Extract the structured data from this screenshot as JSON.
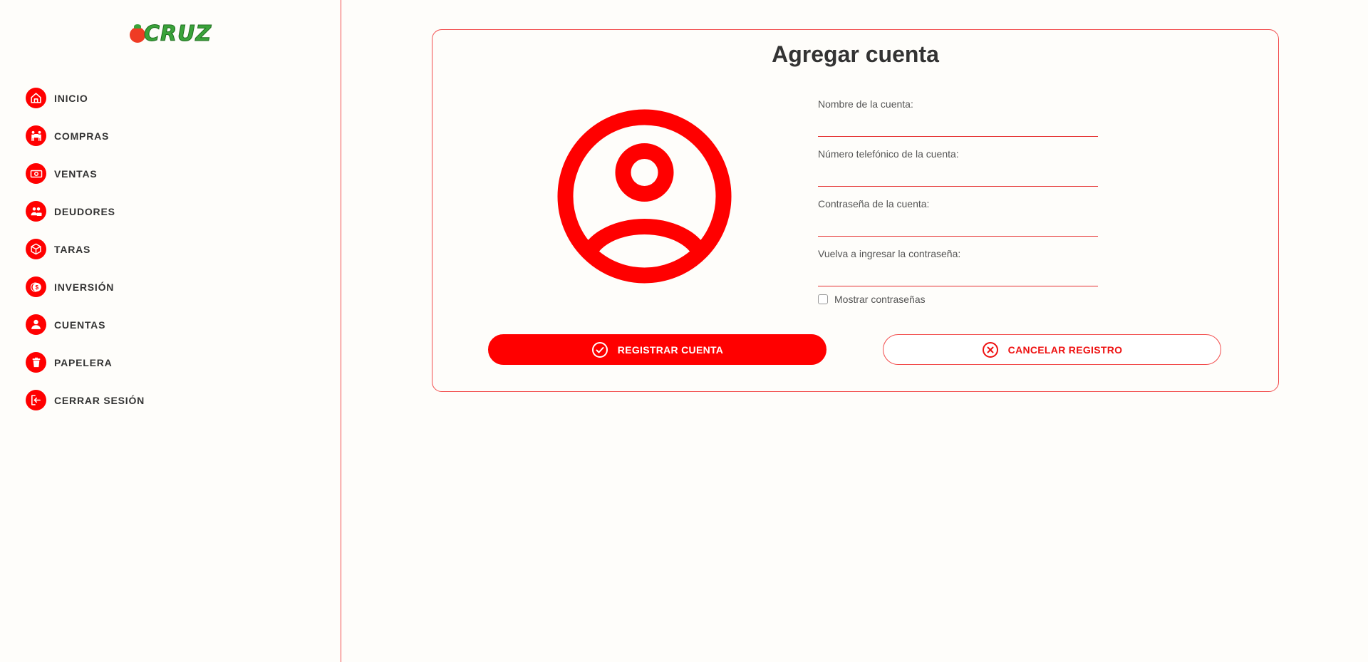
{
  "brand": {
    "logo_text": "CRUZ"
  },
  "sidebar": {
    "items": [
      {
        "label": "INICIO",
        "icon": "home-icon"
      },
      {
        "label": "COMPRAS",
        "icon": "cart-icon"
      },
      {
        "label": "VENTAS",
        "icon": "money-icon"
      },
      {
        "label": "DEUDORES",
        "icon": "debtors-icon"
      },
      {
        "label": "TARAS",
        "icon": "box-icon"
      },
      {
        "label": "INVERSIÓN",
        "icon": "coin-icon"
      },
      {
        "label": "CUENTAS",
        "icon": "user-icon"
      },
      {
        "label": "PAPELERA",
        "icon": "trash-icon"
      },
      {
        "label": "CERRAR SESIÓN",
        "icon": "logout-icon"
      }
    ]
  },
  "form": {
    "title": "Agregar cuenta",
    "fields": [
      {
        "label": "Nombre de la cuenta:",
        "value": ""
      },
      {
        "label": "Número telefónico de la cuenta:",
        "value": ""
      },
      {
        "label": "Contraseña de la cuenta:",
        "value": ""
      },
      {
        "label": "Vuelva a ingresar la contraseña:",
        "value": ""
      }
    ],
    "show_passwords_label": "Mostrar contraseñas",
    "submit_label": "REGISTRAR CUENTA",
    "cancel_label": "CANCELAR REGISTRO"
  },
  "colors": {
    "accent": "#ff0000",
    "border": "#f24b4b",
    "background": "#fefdfa"
  }
}
